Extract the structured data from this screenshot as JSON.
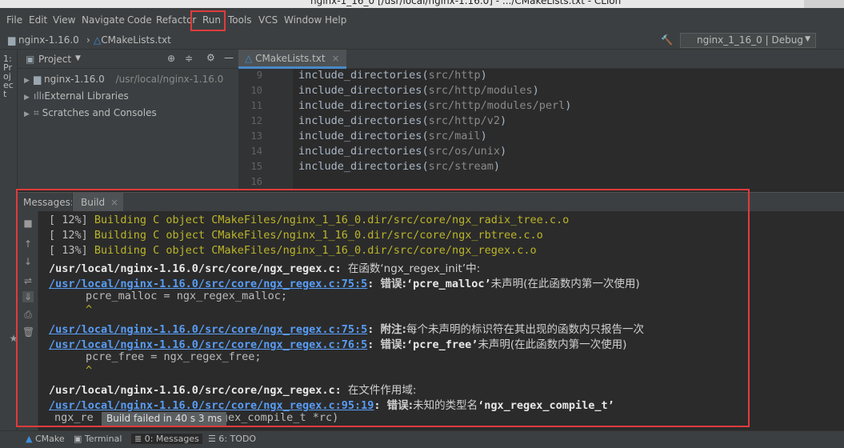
{
  "window": {
    "title": "nginx-1_16_0 [/usr/local/nginx-1.16.0] - .../CMakeLists.txt - CLion"
  },
  "menu": [
    "File",
    "Edit",
    "View",
    "Navigate",
    "Code",
    "Refactor",
    "Run",
    "Tools",
    "VCS",
    "Window",
    "Help"
  ],
  "breadcrumbs": {
    "project": "nginx-1.16.0",
    "file": "CMakeLists.txt"
  },
  "run_config": {
    "label": "nginx_1_16_0 | Debug"
  },
  "left_strip": {
    "label": "1: Project"
  },
  "project_panel": {
    "title": "Project",
    "items": [
      {
        "name": "nginx-1.16.0",
        "path": "/usr/local/nginx-1.16.0"
      },
      {
        "name": "External Libraries"
      },
      {
        "name": "Scratches and Consoles"
      }
    ]
  },
  "editor": {
    "tab": "CMakeLists.txt",
    "lines": [
      {
        "num": "9",
        "fn": "include_directories",
        "arg": "src/http"
      },
      {
        "num": "10",
        "fn": "include_directories",
        "arg": "src/http/modules"
      },
      {
        "num": "11",
        "fn": "include_directories",
        "arg": "src/http/modules/perl"
      },
      {
        "num": "12",
        "fn": "include_directories",
        "arg": "src/http/v2"
      },
      {
        "num": "13",
        "fn": "include_directories",
        "arg": "src/mail"
      },
      {
        "num": "14",
        "fn": "include_directories",
        "arg": "src/os/unix"
      },
      {
        "num": "15",
        "fn": "include_directories",
        "arg": "src/stream"
      },
      {
        "num": "16",
        "fn": "",
        "arg": ""
      }
    ]
  },
  "messages": {
    "tab_label": "Messages:",
    "build_tab": "Build",
    "lines": {
      "b1_pct": "[ 12%]",
      "b1_text": "Building C object CMakeFiles/nginx_1_16_0.dir/src/core/ngx_radix_tree.c.o",
      "b2_pct": "[ 12%]",
      "b2_text": "Building C object CMakeFiles/nginx_1_16_0.dir/src/core/ngx_rbtree.c.o",
      "b3_pct": "[ 13%]",
      "b3_text": "Building C object CMakeFiles/nginx_1_16_0.dir/src/core/ngx_regex.c.o",
      "l4_path": "/usr/local/nginx-1.16.0/src/core/ngx_regex.c:",
      "l4_text": "在函数‘ngx_regex_init’中:",
      "l5_link": "/usr/local/nginx-1.16.0/src/core/ngx_regex.c:75:5",
      "l5_colon": ":",
      "l5_err": "错误:",
      "l5_sym": "‘pcre_malloc’",
      "l5_text": "未声明(在此函数内第一次使用)",
      "l6_code": "pcre_malloc = ngx_regex_malloc;",
      "l7_caret": "^",
      "l8_link": "/usr/local/nginx-1.16.0/src/core/ngx_regex.c:75:5",
      "l8_colon": ":",
      "l8_note": "附注:",
      "l8_text": "每个未声明的标识符在其出现的函数内只报告一次",
      "l9_link": "/usr/local/nginx-1.16.0/src/core/ngx_regex.c:76:5",
      "l9_colon": ":",
      "l9_err": "错误:",
      "l9_sym": "‘pcre_free’",
      "l9_text": "未声明(在此函数内第一次使用)",
      "l10_code": "pcre_free = ngx_regex_free;",
      "l11_caret": "^",
      "l12_path": "/usr/local/nginx-1.16.0/src/core/ngx_regex.c:",
      "l12_text": "在文件作用域:",
      "l13_link": "/usr/local/nginx-1.16.0/src/core/ngx_regex.c:95:19",
      "l13_colon": ":",
      "l13_err": "错误:",
      "l13_text": "未知的类型名",
      "l13_sym": "‘ngx_regex_compile_t’",
      "l14_left": "ngx_re",
      "l14_right": "egex_compile_t *rc)"
    },
    "tooltip": "Build failed in 40 s 3 ms"
  },
  "statusbar": [
    "CMake",
    "Terminal",
    "0: Messages",
    "6: TODO"
  ],
  "colors": {
    "highlight_box": "#e03b3b",
    "link": "#589df6",
    "error": "#ff6b68",
    "note": "#3dbfb4",
    "build_text": "#bbb529"
  }
}
